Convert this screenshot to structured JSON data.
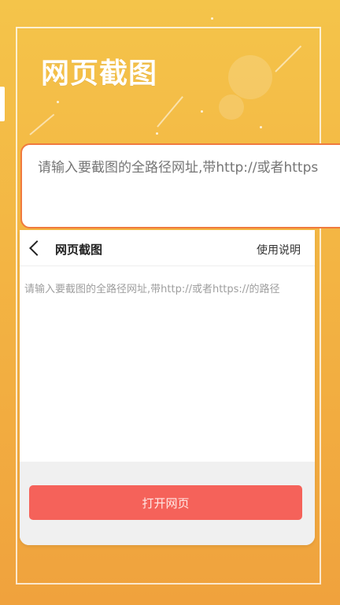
{
  "header": {
    "title": "网页截图"
  },
  "url_card": {
    "placeholder": "请输入要截图的全路径网址,带http://或者https"
  },
  "phone": {
    "nav": {
      "title": "网页截图",
      "help_label": "使用说明"
    },
    "input": {
      "placeholder": "请输入要截图的全路径网址,带http://或者https://的路径"
    },
    "open_button": {
      "label": "打开网页"
    }
  },
  "colors": {
    "background_top": "#f4c44a",
    "background_bottom": "#f0a23d",
    "accent_orange": "#f07a3e",
    "button_red": "#f5625a"
  }
}
